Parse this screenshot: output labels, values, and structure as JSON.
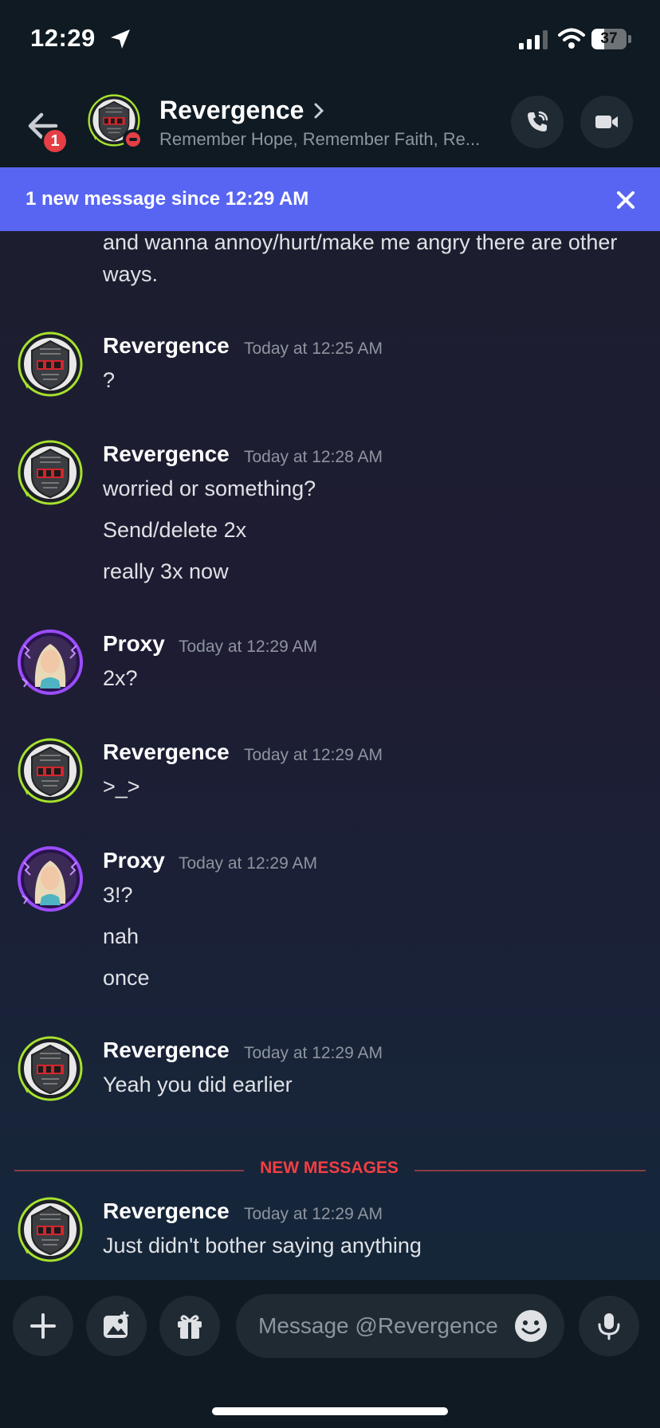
{
  "status_bar": {
    "time": "12:29",
    "battery": "37",
    "battery_level": 0.37
  },
  "header": {
    "back_badge": "1",
    "name": "Revergence",
    "subtitle": "Remember Hope, Remember Faith, Re..."
  },
  "banner": {
    "text": "1 new message since 12:29 AM"
  },
  "messages": {
    "continued_text": "and wanna annoy/hurt/make me angry there are other ways.",
    "groups": [
      {
        "author": "Revergence",
        "timestamp": "Today at 12:25 AM",
        "lines": [
          "?"
        ]
      },
      {
        "author": "Revergence",
        "timestamp": "Today at 12:28 AM",
        "lines": [
          "worried or something?",
          "Send/delete 2x",
          "really 3x now"
        ]
      },
      {
        "author": "Proxy",
        "timestamp": "Today at 12:29 AM",
        "lines": [
          "2x?"
        ]
      },
      {
        "author": "Revergence",
        "timestamp": "Today at 12:29 AM",
        "lines": [
          ">_>"
        ]
      },
      {
        "author": "Proxy",
        "timestamp": "Today at 12:29 AM",
        "lines": [
          "3!?",
          "nah",
          "once"
        ]
      },
      {
        "author": "Revergence",
        "timestamp": "Today at 12:29 AM",
        "lines": [
          "Yeah you did earlier"
        ]
      },
      {
        "author": "Revergence",
        "timestamp": "Today at 12:29 AM",
        "lines": [
          "Just didn't bother saying anything"
        ]
      }
    ],
    "new_messages_label": "NEW MESSAGES"
  },
  "composer": {
    "placeholder": "Message @Revergence"
  },
  "colors": {
    "accent": "#5865f2",
    "danger": "#f23f43",
    "revergence_ring": "#a6e22e",
    "proxy_ring": "#9b4dff"
  },
  "icons": [
    "back-arrow-icon",
    "phone-icon",
    "video-icon",
    "close-icon",
    "plus-icon",
    "image-icon",
    "gift-icon",
    "emoji-icon",
    "mic-icon",
    "location-arrow-icon",
    "signal-icon",
    "wifi-icon"
  ]
}
